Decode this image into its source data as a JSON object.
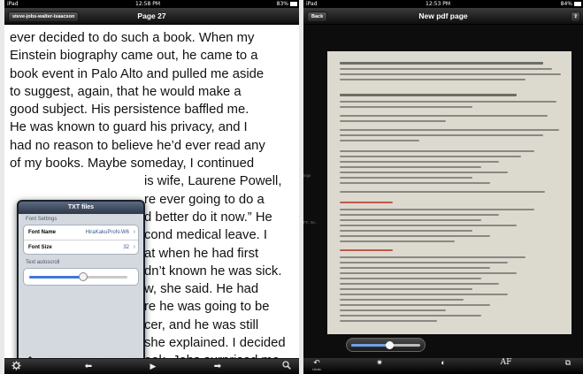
{
  "left": {
    "status": {
      "carrier": "iPad",
      "time": "12:58 PM",
      "battery": "83%"
    },
    "nav": {
      "back_label": "steve-jobs-walter-isaacson",
      "title": "Page 27"
    },
    "book_lines": [
      "ever decided to do such a book. When my",
      "Einstein biography came out, he came to a",
      "book event in Palo Alto and pulled me aside",
      "to suggest, again, that he would make a",
      "good subject. His persistence baffled me.",
      "He was known to guard his privacy, and I",
      "had no reason to believe he’d ever read any",
      "of my books. Maybe someday, I continued",
      "is wife, Laurene Powell,",
      "re ever going to do a",
      "d better do it now.” He",
      "cond medical leave. I",
      "at when he had first",
      "dn’t known he was sick.",
      "w, she said. He had",
      "re he was going to be",
      "cer, and he was still",
      "she explained. I decided",
      "ook. Jobs surprised me"
    ],
    "popover": {
      "title": "TXT files",
      "section_font": "Font Settings",
      "font_name_label": "Font Name",
      "font_name_value": "HiraKakuProN-W6",
      "font_size_label": "Font Size",
      "font_size_value": "32",
      "section_autoscroll": "Text autoscroll",
      "autoscroll_level": 0.55
    },
    "toolbar": {
      "settings_icon": "gear-icon",
      "prev_icon": "arrow-left-icon",
      "play_icon": "play-icon",
      "next_icon": "arrow-right-icon",
      "search_icon": "search-icon"
    }
  },
  "right": {
    "status": {
      "carrier": "iPad",
      "time": "12:53 PM",
      "battery": "84%"
    },
    "nav": {
      "back_label": "Back",
      "title": "New pdf page"
    },
    "margin_labels": [
      "ings",
      "FF, Inc."
    ],
    "zoom_level": 0.55,
    "toolbar": [
      {
        "icon": "rotate-icon",
        "glyph": "↶",
        "label": "Undo"
      },
      {
        "icon": "brightness-icon",
        "glyph": "✷",
        "label": ""
      },
      {
        "icon": "contrast-icon",
        "glyph": "◐",
        "label": ""
      },
      {
        "icon": "autofocus-icon",
        "glyph": "AF",
        "label": ""
      },
      {
        "icon": "crop-icon",
        "glyph": "⧉",
        "label": ""
      }
    ]
  }
}
